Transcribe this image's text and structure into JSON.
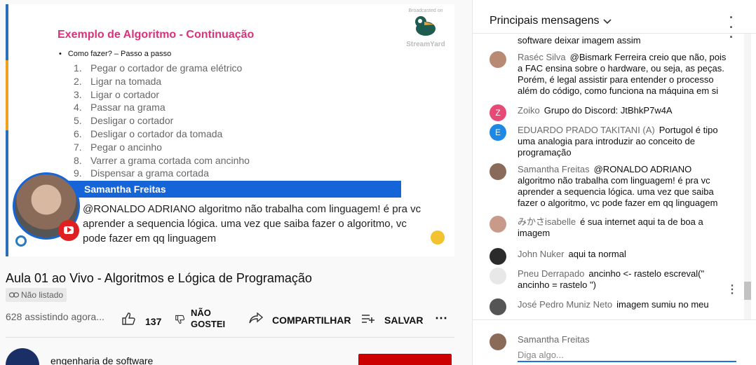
{
  "video": {
    "slide_title": "Exemplo de Algoritmo - Continuação",
    "slide_bullet": "Como fazer? – Passo a passo",
    "steps": [
      {
        "num": "1.",
        "text": "Pegar o cortador de grama elétrico"
      },
      {
        "num": "2.",
        "text": "Ligar na tomada"
      },
      {
        "num": "3.",
        "text": "Ligar o cortador"
      },
      {
        "num": "4.",
        "text": "Passar na grama"
      },
      {
        "num": "5.",
        "text": "Desligar o cortador"
      },
      {
        "num": "6.",
        "text": "Desligar o cortador da tomada"
      },
      {
        "num": "7.",
        "text": "Pegar o ancinho"
      },
      {
        "num": "8.",
        "text": "Varrer a grama cortada com ancinho"
      },
      {
        "num": "9.",
        "text": "Dispensar a grama cortada"
      }
    ],
    "streamyard_small": "Broadcasted on",
    "streamyard_big": "StreamYard",
    "banner_name": "Samantha Freitas",
    "banner_text": "@RONALDO ADRIANO algoritmo não trabalha com linguagem! é pra vc aprender a sequencia lógica. uma vez que saiba fazer o algoritmo, vc pode fazer em qq linguagem"
  },
  "info": {
    "title": "Aula 01 ao Vivo - Algoritmos e Lógica de Programação",
    "unlisted": "Não listado",
    "viewers": "628 assistindo agora...",
    "likes": "137",
    "dislike": "NÃO GOSTEI",
    "share": "COMPARTILHAR",
    "save": "SALVAR",
    "channel": "engenharia de software"
  },
  "chat": {
    "title": "Principais mensagens",
    "messages": [
      {
        "author": "",
        "text": "software deixar imagem assim",
        "avatar_color": "#ffffff",
        "initial": ""
      },
      {
        "author": "Raséc Silva",
        "text": "@Bismark Ferreira creio que não, pois a FAC ensina sobre o hardware, ou seja, as peças. Porém, é legal assistir para entender o processo além do código, como funciona na máquina em si",
        "avatar_color": "#b88a74",
        "initial": ""
      },
      {
        "author": "Zoiko",
        "text": "Grupo do Discord: JtBhkP7w4A",
        "avatar_color": "#e84a78",
        "initial": "Z"
      },
      {
        "author": "EDUARDO PRADO TAKITANI (A)",
        "text": "Portugol é tipo uma analogia para introduzir ao conceito de programação",
        "avatar_color": "#1e88e5",
        "initial": "E"
      },
      {
        "author": "Samantha Freitas",
        "text": "@RONALDO ADRIANO algoritmo não trabalha com linguagem! é pra vc aprender a sequencia lógica. uma vez que saiba fazer o algoritmo, vc pode fazer em qq linguagem",
        "avatar_color": "#8a6a58",
        "initial": ""
      },
      {
        "author": "みかさisabelle",
        "text": "é sua internet aqui ta de boa a imagem",
        "avatar_color": "#c79a8a",
        "initial": ""
      },
      {
        "author": "John Nuker",
        "text": "aqui ta normal",
        "avatar_color": "#2b2b2b",
        "initial": ""
      },
      {
        "author": "Pneu Derrapado",
        "text": "ancinho <- rastelo escreval(\" ancinho = rastelo \")",
        "avatar_color": "#e8e8e8",
        "initial": ""
      },
      {
        "author": "José Pedro Muniz Neto",
        "text": "imagem sumiu no meu",
        "avatar_color": "#555555",
        "initial": ""
      }
    ],
    "input_name": "Samantha Freitas",
    "input_placeholder": "Diga algo..."
  }
}
